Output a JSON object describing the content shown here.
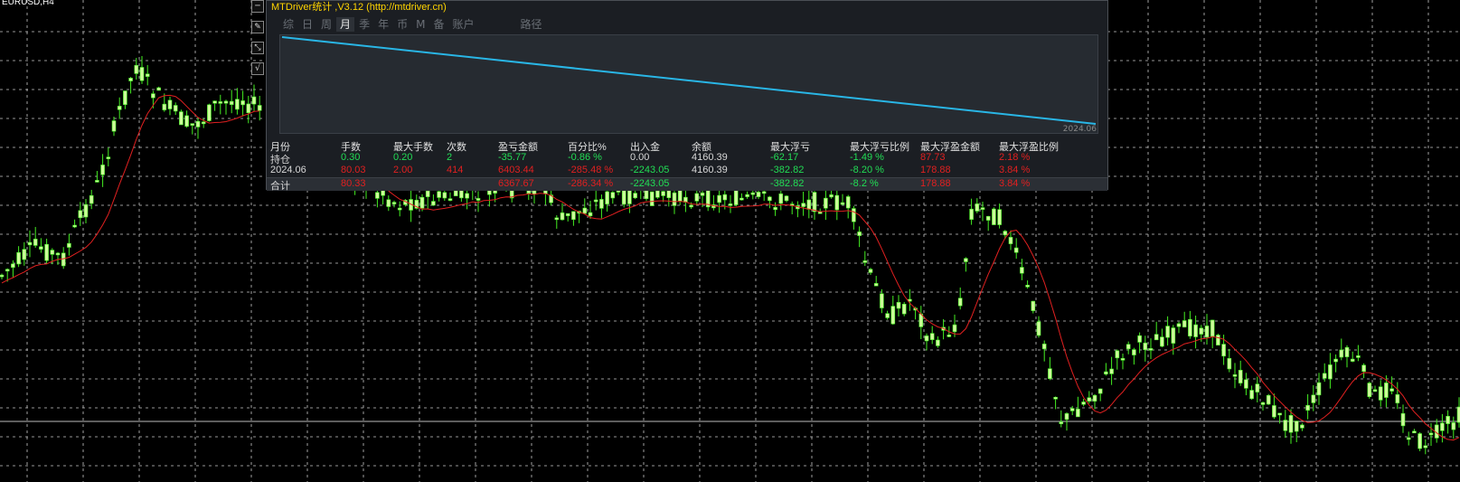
{
  "chart": {
    "symbol": "EURUSD,H4",
    "bull_color": "#ccff99",
    "bear_color": "#ccff99",
    "wick_color": "#44ee22",
    "ma_color": "#e02020",
    "grid_color": "#c8c8c8",
    "price_line_color": "#bbbbbb"
  },
  "side_buttons": [
    "square-icon",
    "edit-icon",
    "resize-icon",
    "check-icon"
  ],
  "panel": {
    "title": "MTDriver统计 ,V3.12 (http://mtdriver.cn)",
    "tabs": [
      {
        "label": "综",
        "active": false
      },
      {
        "label": "日",
        "active": false
      },
      {
        "label": "周",
        "active": false
      },
      {
        "label": "月",
        "active": true
      },
      {
        "label": "季",
        "active": false
      },
      {
        "label": "年",
        "active": false
      },
      {
        "label": "币",
        "active": false
      },
      {
        "label": "M",
        "active": false
      },
      {
        "label": "备",
        "active": false
      },
      {
        "label": "账户",
        "active": false
      },
      {
        "label": "路径",
        "active": false
      }
    ],
    "equity_line_color": "#29b6e6",
    "equity_end_label": "2024.06",
    "columns": [
      "月份",
      "手数",
      "最大手数",
      "次数",
      "盈亏金额",
      "百分比%",
      "出入金",
      "余额",
      "最大浮亏",
      "最大浮亏比例",
      "最大浮盈金额",
      "最大浮盈比例"
    ],
    "rows": [
      {
        "cells": [
          "持仓",
          "0.30",
          "0.20",
          "2",
          "-35.77",
          "-0.86 %",
          "0.00",
          "4160.39",
          "-62.17",
          "-1.49 %",
          "87.73",
          "2.18 %"
        ],
        "colors": [
          "c-white",
          "c-green",
          "c-green",
          "c-green",
          "c-green",
          "c-green",
          "c-white",
          "c-white",
          "c-green",
          "c-green",
          "c-red",
          "c-red"
        ]
      },
      {
        "cells": [
          "2024.06",
          "80.03",
          "2.00",
          "414",
          "6403.44",
          "-285.48 %",
          "-2243.05",
          "4160.39",
          "-382.82",
          "-8.20 %",
          "178.88",
          "3.84 %"
        ],
        "colors": [
          "c-white",
          "c-red",
          "c-red",
          "c-red",
          "c-red",
          "c-red",
          "c-green",
          "c-white",
          "c-green",
          "c-green",
          "c-red",
          "c-red"
        ]
      },
      {
        "cells": [
          "合计",
          "80.33",
          "",
          "",
          "6367.67",
          "-286.34 %",
          "-2243.05",
          "",
          "-382.82",
          "-8.2 %",
          "178.88",
          "3.84 %"
        ],
        "colors": [
          "c-white",
          "c-red",
          "c-red",
          "c-red",
          "c-red",
          "c-red",
          "c-green",
          "c-white",
          "c-green",
          "c-green",
          "c-red",
          "c-red"
        ]
      }
    ]
  }
}
